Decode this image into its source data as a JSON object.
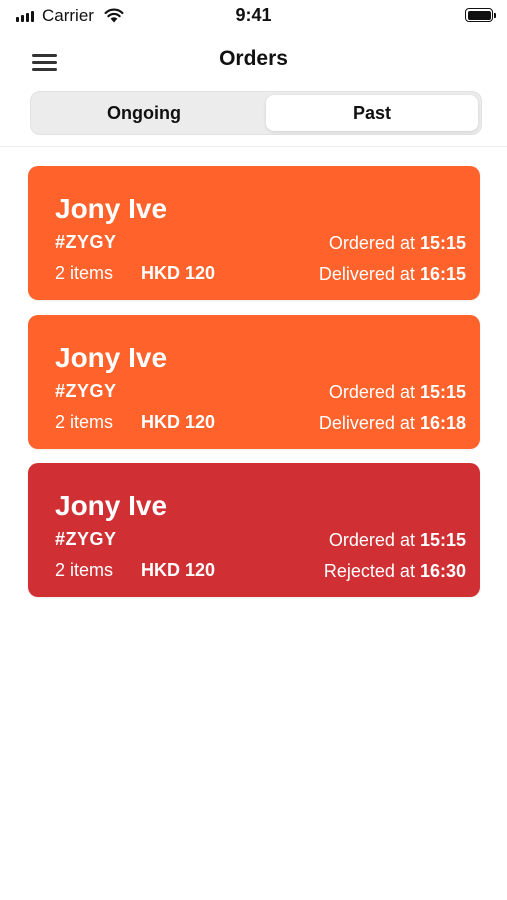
{
  "status_bar": {
    "carrier": "Carrier",
    "time": "9:41",
    "signal_icon": "signal-bars-icon",
    "wifi_icon": "wifi-icon",
    "battery_icon": "battery-icon"
  },
  "nav": {
    "title": "Orders",
    "menu_icon": "hamburger-menu-icon"
  },
  "tabs": {
    "ongoing_label": "Ongoing",
    "past_label": "Past",
    "selected": "Past"
  },
  "colors": {
    "delivered_card": "#ff622b",
    "rejected_card": "#d03034",
    "text_on_card": "#ffffff"
  },
  "orders": [
    {
      "customer": "Jony Ive",
      "code": "#ZYGY",
      "items": "2 items",
      "amount": "HKD 120",
      "ordered_label": "Ordered at ",
      "ordered_time": "15:15",
      "status_label": "Delivered at ",
      "status_time": "16:15",
      "status": "delivered"
    },
    {
      "customer": "Jony Ive",
      "code": "#ZYGY",
      "items": "2 items",
      "amount": "HKD 120",
      "ordered_label": "Ordered at ",
      "ordered_time": "15:15",
      "status_label": "Delivered at ",
      "status_time": "16:18",
      "status": "delivered"
    },
    {
      "customer": "Jony Ive",
      "code": "#ZYGY",
      "items": "2 items",
      "amount": "HKD 120",
      "ordered_label": "Ordered at ",
      "ordered_time": "15:15",
      "status_label": "Rejected at ",
      "status_time": "16:30",
      "status": "rejected"
    }
  ]
}
